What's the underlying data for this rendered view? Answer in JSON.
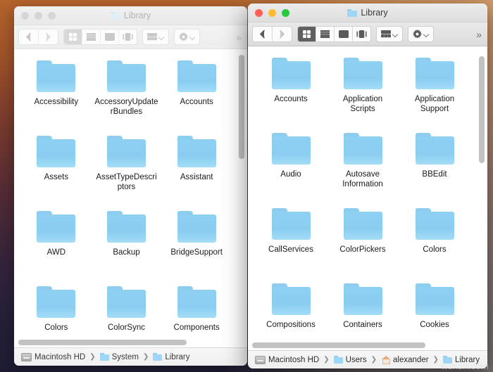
{
  "desktop": {
    "gradient_top": "#b4642c",
    "gradient_bottom": "#1e1c33",
    "watermark": "wsxdn.com"
  },
  "folder_color": "#8bcdf0",
  "windows": [
    {
      "id": "system-library",
      "title": "Library",
      "state": "inactive",
      "traffic_lights": [
        "close",
        "minimize",
        "zoom"
      ],
      "toolbar": {
        "back_label": "Back",
        "forward_label": "Forward",
        "view_buttons": [
          {
            "name": "icon-view",
            "selected": true
          },
          {
            "name": "list-view",
            "selected": false
          },
          {
            "name": "column-view",
            "selected": false
          },
          {
            "name": "gallery-view",
            "selected": false
          }
        ],
        "group_label": "Group",
        "action_label": "Action",
        "overflow_label": "»"
      },
      "items": [
        {
          "name": "Accessibility"
        },
        {
          "name": "AccessoryUpdaterBundles"
        },
        {
          "name": "Accounts"
        },
        {
          "name": "Assets"
        },
        {
          "name": "AssetTypeDescriptors"
        },
        {
          "name": "Assistant"
        },
        {
          "name": "AWD"
        },
        {
          "name": "Backup"
        },
        {
          "name": "BridgeSupport"
        },
        {
          "name": "Colors"
        },
        {
          "name": "ColorSync"
        },
        {
          "name": "Components"
        }
      ],
      "path": [
        {
          "label": "Macintosh HD",
          "icon": "disk-icon"
        },
        {
          "label": "System",
          "icon": "folder-icon"
        },
        {
          "label": "Library",
          "icon": "folder-icon"
        }
      ]
    },
    {
      "id": "user-library",
      "title": "Library",
      "state": "active",
      "traffic_lights": [
        "close",
        "minimize",
        "zoom"
      ],
      "toolbar": {
        "back_label": "Back",
        "forward_label": "Forward",
        "view_buttons": [
          {
            "name": "icon-view",
            "selected": true
          },
          {
            "name": "list-view",
            "selected": false
          },
          {
            "name": "column-view",
            "selected": false
          },
          {
            "name": "gallery-view",
            "selected": false
          }
        ],
        "group_label": "Group",
        "action_label": "Action",
        "overflow_label": "»"
      },
      "items": [
        {
          "name": "Accounts"
        },
        {
          "name": "Application Scripts"
        },
        {
          "name": "Application Support"
        },
        {
          "name": "Audio"
        },
        {
          "name": "Autosave Information"
        },
        {
          "name": "BBEdit"
        },
        {
          "name": "CallServices"
        },
        {
          "name": "ColorPickers"
        },
        {
          "name": "Colors"
        },
        {
          "name": "Compositions"
        },
        {
          "name": "Containers"
        },
        {
          "name": "Cookies"
        }
      ],
      "path": [
        {
          "label": "Macintosh HD",
          "icon": "disk-icon"
        },
        {
          "label": "Users",
          "icon": "folder-icon"
        },
        {
          "label": "alexander",
          "icon": "home-icon"
        },
        {
          "label": "Library",
          "icon": "folder-icon"
        }
      ]
    }
  ]
}
